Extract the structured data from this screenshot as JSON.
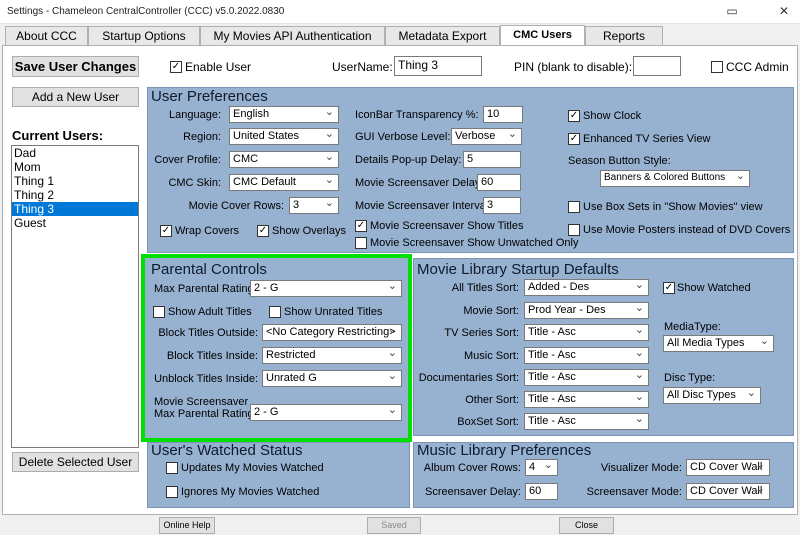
{
  "window": {
    "title": "Settings - Chameleon CentralController (CCC) v5.0.2022.0830"
  },
  "tabs": [
    "About CCC",
    "Startup Options",
    "My Movies API Authentication",
    "Metadata Export",
    "CMC Users",
    "Reports"
  ],
  "top": {
    "save_label": "Save User Changes",
    "enable_user": "Enable User",
    "username_label": "UserName:",
    "username_value": "Thing 3",
    "pin_label": "PIN (blank to disable):",
    "pin_value": "",
    "ccc_admin": "CCC Admin"
  },
  "users": {
    "add_label": "Add a New User",
    "current_label": "Current Users:",
    "list": [
      "Dad",
      "Mom",
      "Thing 1",
      "Thing 2",
      "Thing 3",
      "Guest"
    ],
    "selected": "Thing 3",
    "delete_label": "Delete Selected User"
  },
  "prefs": {
    "title": "User Preferences",
    "language_label": "Language:",
    "language": "English",
    "region_label": "Region:",
    "region": "United States",
    "cover_label": "Cover Profile:",
    "cover": "CMC",
    "skin_label": "CMC Skin:",
    "skin": "CMC Default",
    "rows_label": "Movie Cover Rows:",
    "rows": "3",
    "wrap": "Wrap Covers",
    "overlays": "Show Overlays",
    "iconbar_label": "IconBar Transparency %:",
    "iconbar": "10",
    "verbose_label": "GUI Verbose Level:",
    "verbose": "Verbose",
    "popup_label": "Details Pop-up Delay:",
    "popup": "5",
    "ssdelay_label": "Movie Screensaver Delay:",
    "ssdelay": "60",
    "ssint_label": "Movie Screensaver Interval:",
    "ssint": "3",
    "sstitles": "Movie Screensaver Show Titles",
    "ssunwatched": "Movie Screensaver Show Unwatched Only",
    "clock": "Show Clock",
    "enhanced": "Enhanced TV Series View",
    "season_label": "Season Button Style:",
    "season": "Banners & Colored Buttons",
    "boxsets": "Use Box Sets in \"Show Movies\" view",
    "posters": "Use Movie Posters instead of DVD Covers"
  },
  "parental": {
    "title": "Parental Controls",
    "max_label": "Max Parental Rating:",
    "max": "2 - G",
    "adult": "Show Adult Titles",
    "unrated": "Show Unrated Titles",
    "outside_label": "Block Titles Outside:",
    "outside": "<No Category Restricting>",
    "inside_label": "Block Titles Inside:",
    "inside": "Restricted",
    "unblock_label": "Unblock Titles Inside:",
    "unblock": "Unrated G",
    "ss_label1": "Movie Screensaver",
    "ss_label2": "Max Parental Rating:",
    "ss": "2 - G"
  },
  "library": {
    "title": "Movie Library Startup Defaults",
    "all_label": "All Titles Sort:",
    "all": "Added - Des",
    "movie_label": "Movie Sort:",
    "movie": "Prod Year - Des",
    "tv_label": "TV Series Sort:",
    "tv": "Title - Asc",
    "music_label": "Music Sort:",
    "music": "Title - Asc",
    "doc_label": "Documentaries Sort:",
    "doc": "Title - Asc",
    "other_label": "Other Sort:",
    "other": "Title - Asc",
    "boxset_label": "BoxSet Sort:",
    "boxset": "Title - Asc",
    "watched": "Show Watched",
    "media_label": "MediaType:",
    "media": "All Media Types",
    "disc_label": "Disc Type:",
    "disc": "All Disc Types"
  },
  "watched": {
    "title": "User's Watched Status",
    "updates": "Updates My Movies Watched",
    "ignores": "Ignores My Movies Watched"
  },
  "music": {
    "title": "Music Library Preferences",
    "rows_label": "Album Cover Rows:",
    "rows": "4",
    "ssdelay_label": "Screensaver Delay:",
    "ssdelay": "60",
    "vis_label": "Visualizer Mode:",
    "vis": "CD Cover Wall",
    "ssmode_label": "Screensaver Mode:",
    "ssmode": "CD Cover Wall"
  },
  "bottom": {
    "help": "Online Help",
    "saved": "Saved",
    "close": "Close"
  }
}
